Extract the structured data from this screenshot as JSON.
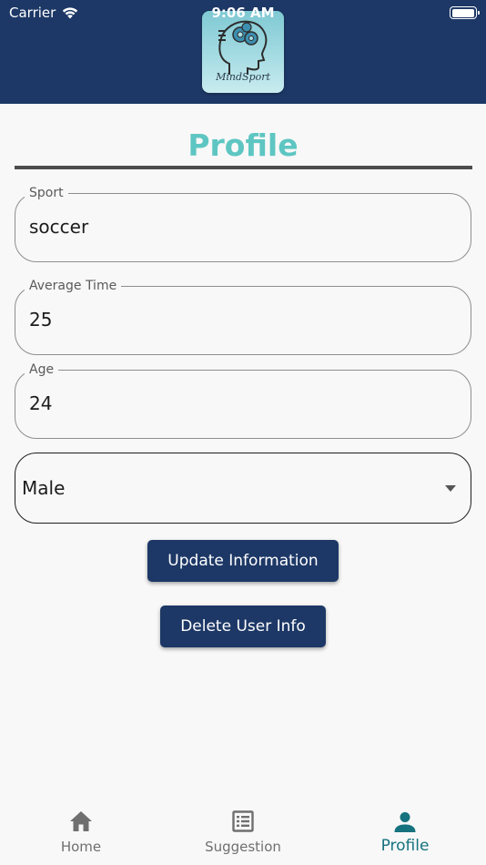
{
  "status_bar": {
    "carrier": "Carrier",
    "time": "9:06 AM",
    "battery_level": 1.0
  },
  "header": {
    "logo_text": "MindSport",
    "background_color": "#1d3866"
  },
  "page": {
    "title": "Profile",
    "title_color": "#5ec6c2"
  },
  "form": {
    "sport": {
      "label": "Sport",
      "value": "soccer"
    },
    "average_time": {
      "label": "Average Time",
      "value": "25"
    },
    "age": {
      "label": "Age",
      "value": "24"
    },
    "gender": {
      "selected": "Male"
    }
  },
  "buttons": {
    "update": "Update Information",
    "delete": "Delete User Info"
  },
  "bottom_nav": {
    "items": [
      {
        "label": "Home",
        "icon": "home-icon",
        "active": false
      },
      {
        "label": "Suggestion",
        "icon": "list-icon",
        "active": false
      },
      {
        "label": "Profile",
        "icon": "person-icon",
        "active": true
      }
    ],
    "active_color": "#16727e"
  }
}
